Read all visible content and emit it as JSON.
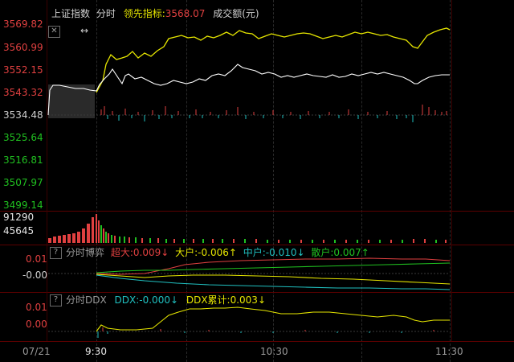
{
  "top_panel": {
    "index_name": "上证指数",
    "period": "分时",
    "leading_label": "领先指标:",
    "leading_value": "3568.07",
    "turnover_label": "成交额(元)",
    "y_ticks": [
      "3569.82",
      "3560.99",
      "3552.15",
      "3543.32",
      "3534.48",
      "3525.64",
      "3516.81",
      "3507.97",
      "3499.14"
    ],
    "colors": {
      "price_line": "#ffffff",
      "leading_line": "#e6e600",
      "up": "#e04040",
      "down": "#20c0c0"
    }
  },
  "volume_panel": {
    "y_ticks": [
      "91290",
      "45645"
    ]
  },
  "game_panel": {
    "title": "分时博弈",
    "super_large": "超大:0.009↓",
    "large": "大户:-0.006↑",
    "medium": "中户:-0.010↓",
    "retail": "散户:0.007↑",
    "y_ticks": [
      "0.01",
      "-0.00"
    ]
  },
  "ddx_panel": {
    "title": "分时DDX",
    "ddx": "DDX:-0.000↓",
    "ddx_cum": "DDX累计:0.003↓",
    "y_ticks": [
      "0.01",
      "0.00"
    ]
  },
  "time_axis": {
    "date": "07/21",
    "ticks": [
      "9:30",
      "10:30",
      "11:30"
    ]
  }
}
